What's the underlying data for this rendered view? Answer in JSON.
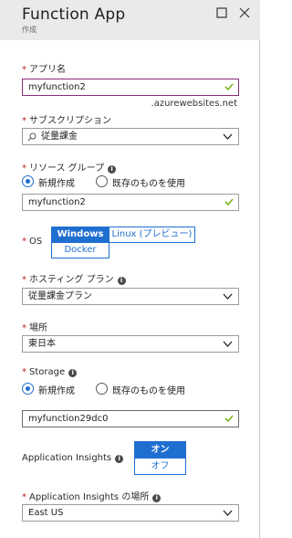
{
  "header": {
    "title": "Function App",
    "subtitle": "作成"
  },
  "app_name": {
    "label": "アプリ名",
    "value": "myfunction2",
    "suffix": ".azurewebsites.net"
  },
  "subscription": {
    "label": "サブスクリプション",
    "value": "従量課金"
  },
  "resource_group": {
    "label": "リソース グループ",
    "options": [
      "新規作成",
      "既存のものを使用"
    ],
    "selected": "新規作成",
    "value": "myfunction2"
  },
  "os": {
    "label": "OS",
    "options": [
      "Windows",
      "Linux (プレビュー)",
      "Docker"
    ],
    "selected": "Windows"
  },
  "hosting_plan": {
    "label": "ホスティング プラン",
    "value": "従量課金プラン"
  },
  "location": {
    "label": "場所",
    "value": "東日本"
  },
  "storage": {
    "label": "Storage",
    "options": [
      "新規作成",
      "既存のものを使用"
    ],
    "selected": "新規作成",
    "value": "myfunction29dc0"
  },
  "app_insights": {
    "label": "Application Insights",
    "options": [
      "オン",
      "オフ"
    ],
    "selected": "オン"
  },
  "app_insights_location": {
    "label": "Application Insights の場所",
    "value": "East US"
  },
  "colors": {
    "accent": "#1f6fd1",
    "valid": "#7ab51d",
    "active_border": "#8a2a78",
    "required": "#c21d1d"
  }
}
